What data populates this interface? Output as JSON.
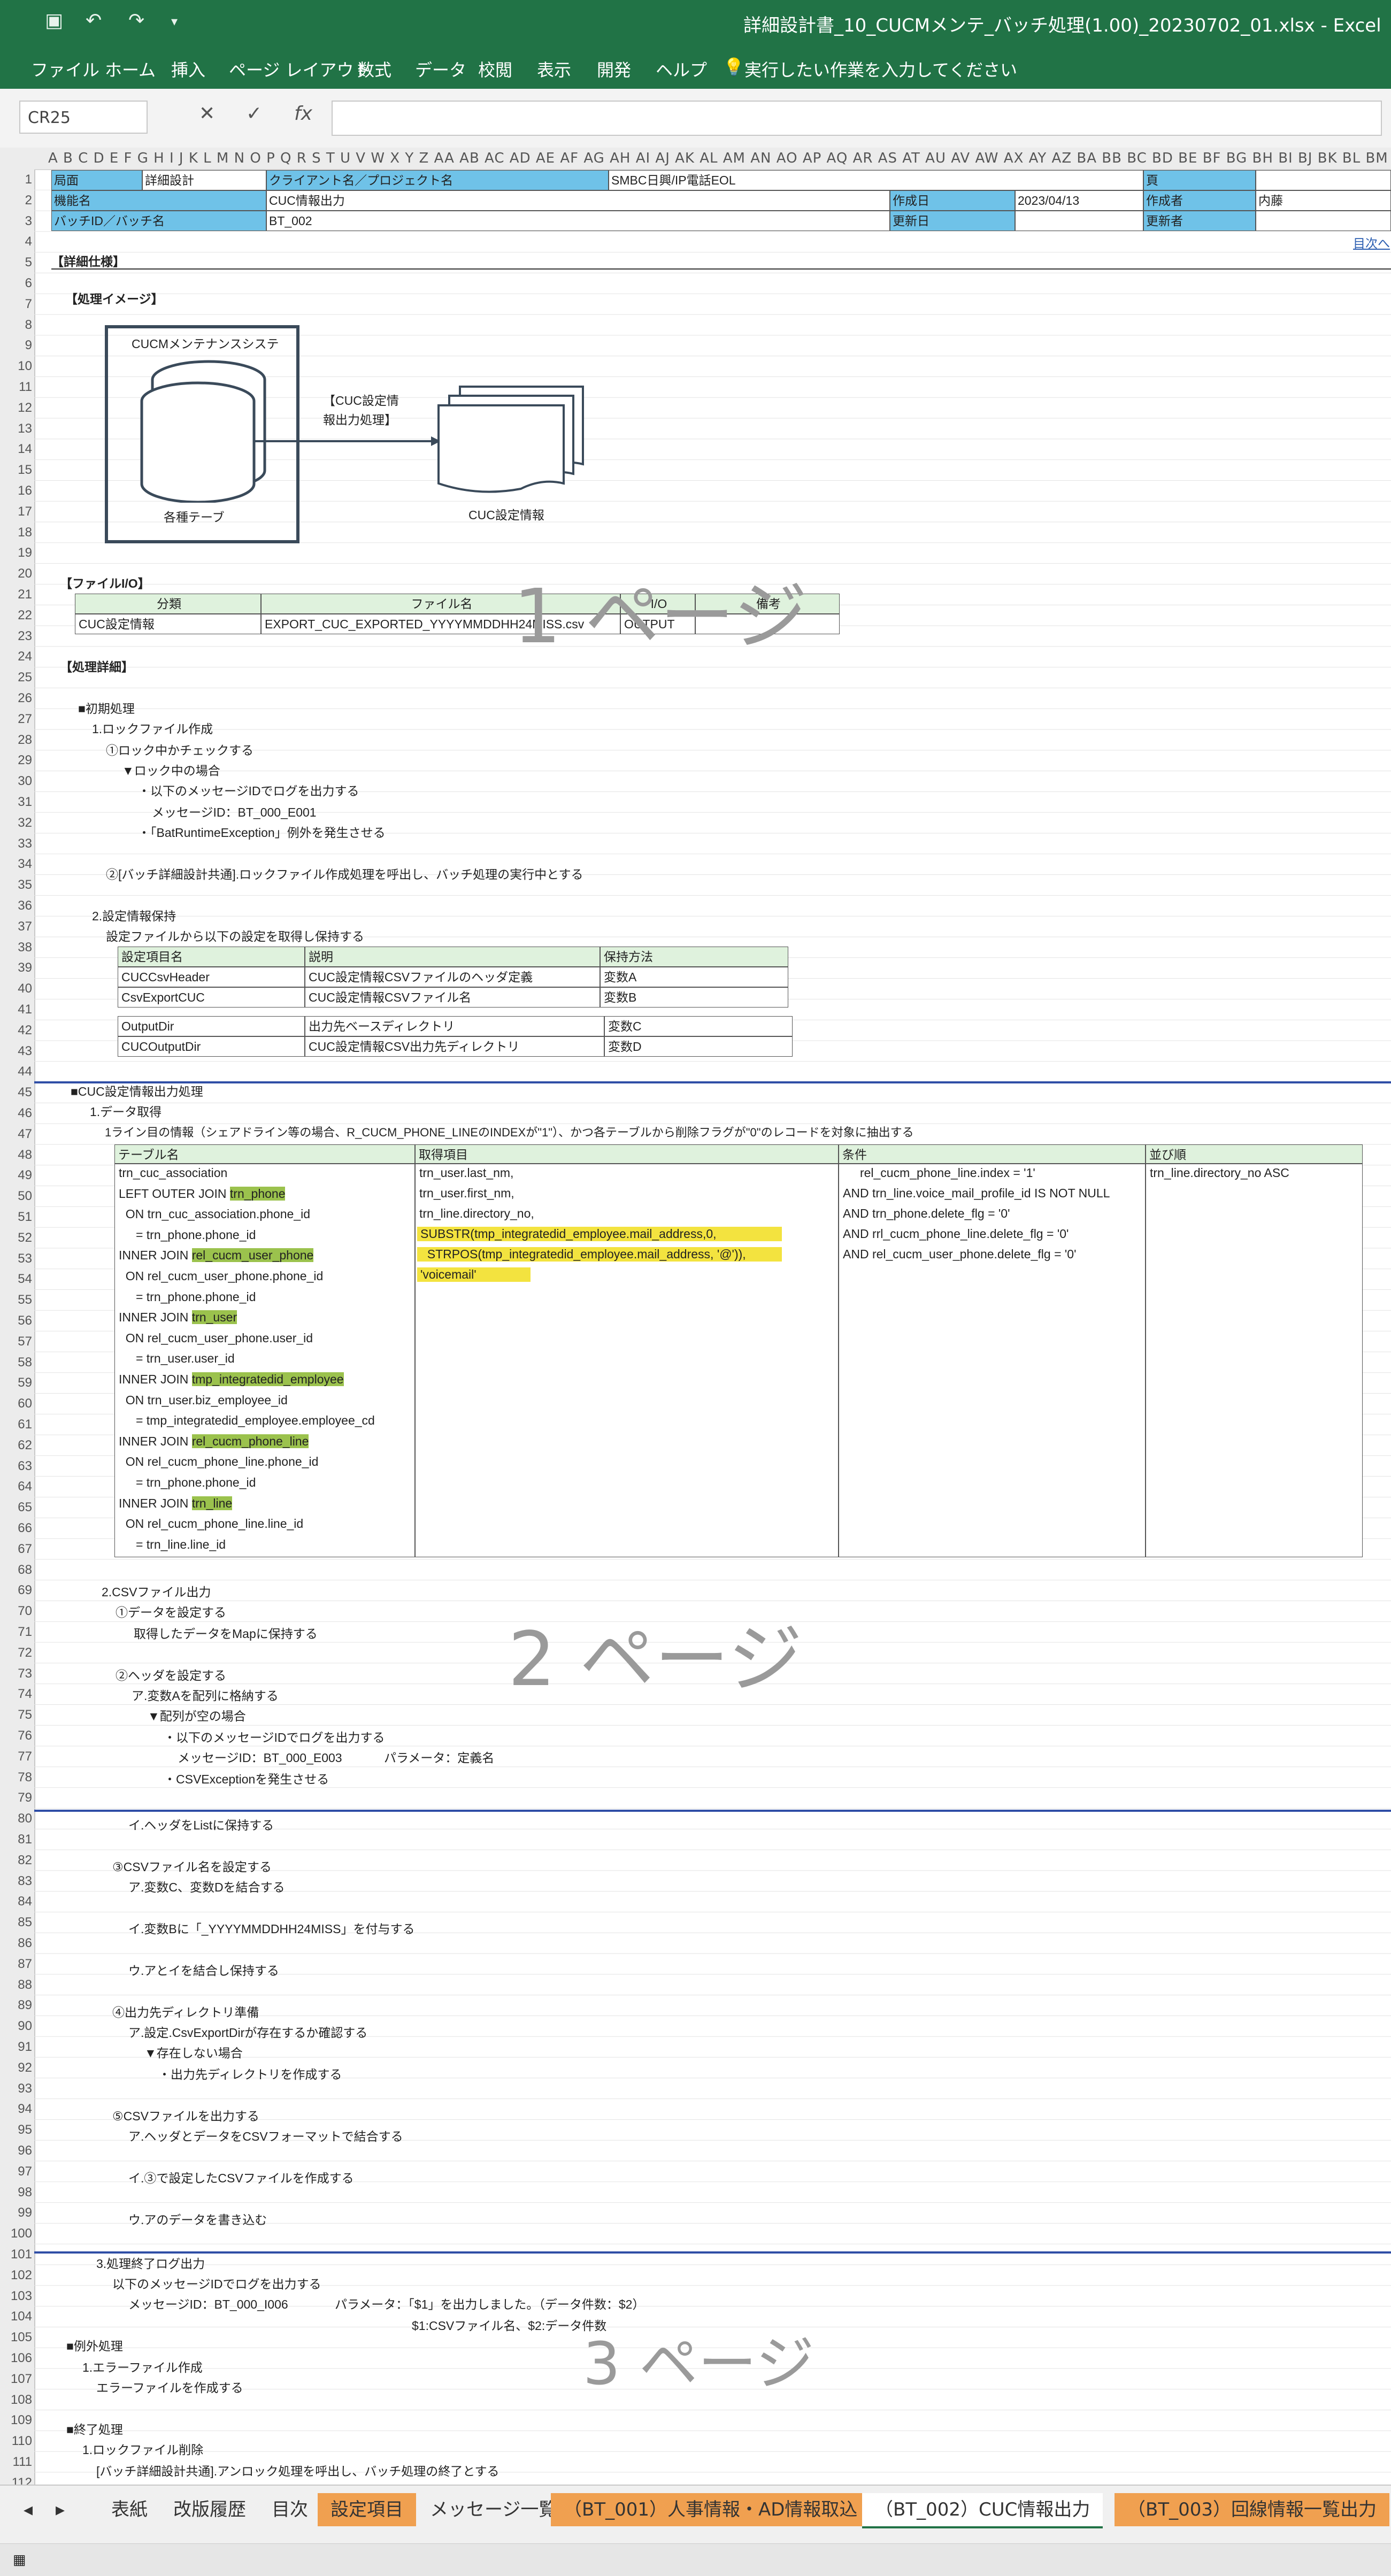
{
  "window": {
    "title": "詳細設計書_10_CUCMメンテ_バッチ処理(1.00)_20230702_01.xlsx  -  Excel"
  },
  "ribbon": {
    "tabs": [
      "ファイル",
      "ホーム",
      "挿入",
      "ページ レイアウト",
      "数式",
      "データ",
      "校閲",
      "表示",
      "開発",
      "ヘルプ"
    ],
    "tell_me": "実行したい作業を入力してください"
  },
  "formula_bar": {
    "name_box": "CR25",
    "cancel": "✕",
    "enter": "✓",
    "fx": "fx",
    "content": ""
  },
  "column_header_text": "A B C D E F G H  I  J K L M N O P Q R S T U V W X Y Z AA AB AC AD AE AF AG AH AI AJ AK AL AM AN AO AP AQ AR AS AT AU AV AW AX AY AZ BA BB BC BD BE BF BG BH BI BJ BK BL BM BN BO BP BQ BR BS BT BU BV BW BX BY BZ CA CB CC CD CE CF CG",
  "header": {
    "r1": [
      "局面",
      "詳細設計",
      "クライアント名／プロジェクト名",
      "SMBC日興/IP電話EOL",
      "頁"
    ],
    "r2": [
      "機能名",
      "CUC情報出力",
      "作成日",
      "2023/04/13",
      "作成者",
      "内藤"
    ],
    "r3": [
      "バッチID／バッチ名",
      "BT_002",
      "更新日",
      "更新者"
    ],
    "toc_link": "目次へ"
  },
  "section_detail": "【詳細仕様】",
  "process_image": {
    "heading": "【処理イメージ】",
    "system_label": "CUCMメンテナンスシステ",
    "db_label": "各種テーブ",
    "arrow_label_1": "【CUC設定情",
    "arrow_label_2": "報出力処理】",
    "doc_label": "CUC設定情報"
  },
  "file_io": {
    "heading": "【ファイルI/O】",
    "headers": [
      "分類",
      "ファイル名",
      "I/O",
      "備考"
    ],
    "row": [
      "CUC設定情報",
      "EXPORT_CUC_EXPORTED_YYYYMMDDHH24MISS.csv",
      "OUTPUT",
      ""
    ]
  },
  "process_detail_heading": "【処理詳細】",
  "init": {
    "title": "■初期処理",
    "lines": [
      "1.ロックファイル作成",
      "①ロック中かチェックする",
      "▼ロック中の場合",
      "・以下のメッセージIDでログを出力する",
      "メッセージID：BT_000_E001",
      "・「BatRuntimeException」例外を発生させる",
      "②[バッチ詳細設計共通].ロックファイル作成処理を呼出し、バッチ処理の実行中とする",
      "2.設定情報保持",
      "設定ファイルから以下の設定を取得し保持する"
    ]
  },
  "settings_table": {
    "headers": [
      "設定項目名",
      "説明",
      "保持方法"
    ],
    "rows": [
      [
        "CUCCsvHeader",
        "CUC設定情報CSVファイルのヘッダ定義",
        "変数A"
      ],
      [
        "CsvExportCUC",
        "CUC設定情報CSVファイル名",
        "変数B"
      ],
      [
        "OutputDir",
        "出力先ベースディレクトリ",
        "変数C"
      ],
      [
        "CUCOutputDir",
        "CUC設定情報CSV出力先ディレクトリ",
        "変数D"
      ]
    ]
  },
  "cuc_output": {
    "title": "■CUC設定情報出力処理",
    "sub": "1.データ取得",
    "desc": "1ライン目の情報（シェアドライン等の場合、R_CUCM_PHONE_LINEのINDEXが\"1\"）、かつ各テーブルから削除フラグが\"0\"のレコードを対象に抽出する"
  },
  "query_table": {
    "headers": [
      "テーブル名",
      "取得項目",
      "条件",
      "並び順"
    ],
    "tables": [
      [
        "trn_cuc_association",
        ""
      ],
      [
        "LEFT OUTER JOIN ",
        "trn_phone"
      ],
      [
        "  ON trn_cuc_association.phone_id",
        ""
      ],
      [
        "     = trn_phone.phone_id",
        ""
      ],
      [
        "INNER JOIN ",
        "rel_cucm_user_phone"
      ],
      [
        "  ON rel_cucm_user_phone.phone_id",
        ""
      ],
      [
        "     = trn_phone.phone_id",
        ""
      ],
      [
        "INNER JOIN ",
        "trn_user"
      ],
      [
        "  ON rel_cucm_user_phone.user_id",
        ""
      ],
      [
        "     = trn_user.user_id",
        ""
      ],
      [
        "INNER JOIN ",
        "tmp_integratedid_employee"
      ],
      [
        "  ON trn_user.biz_employee_id",
        ""
      ],
      [
        "     = tmp_integratedid_employee.employee_cd",
        ""
      ],
      [
        "INNER JOIN ",
        "rel_cucm_phone_line"
      ],
      [
        "  ON rel_cucm_phone_line.phone_id",
        ""
      ],
      [
        "     = trn_phone.phone_id",
        ""
      ],
      [
        "INNER JOIN ",
        "trn_line"
      ],
      [
        "  ON rel_cucm_phone_line.line_id",
        ""
      ],
      [
        "     = trn_line.line_id",
        ""
      ]
    ],
    "items": [
      "trn_user.last_nm,",
      "trn_user.first_nm,",
      "trn_line.directory_no,",
      "SUBSTR(tmp_integratedid_employee.mail_address,0,",
      "  STRPOS(tmp_integratedid_employee.mail_address, '@')),",
      "'voicemail'"
    ],
    "conditions": [
      "     rel_cucm_phone_line.index = '1'",
      "AND trn_line.voice_mail_profile_id IS NOT NULL",
      "AND trn_phone.delete_flg = '0'",
      "AND rrl_cucm_phone_line.delete_flg = '0'",
      "AND rel_cucm_user_phone.delete_flg = '0'"
    ],
    "order": "trn_line.directory_no ASC"
  },
  "csv_output": {
    "lines_a": [
      "2.CSVファイル出力",
      "①データを設定する",
      "取得したデータをMapに保持する",
      "②ヘッダを設定する",
      "ア.変数Aを配列に格納する",
      "▼配列が空の場合",
      "・以下のメッセージIDでログを出力する",
      "メッセージID：BT_000_E003",
      "パラメータ：定義名",
      "・CSVExceptionを発生させる"
    ],
    "lines_b": [
      "イ.ヘッダをListに保持する",
      "③CSVファイル名を設定する",
      "ア.変数C、変数Dを結合する",
      "イ.変数Bに「_YYYYMMDDHH24MISS」を付与する",
      "ウ.アとイを結合し保持する",
      "④出力先ディレクトリ準備",
      "ア.設定.CsvExportDirが存在するか確認する",
      "▼存在しない場合",
      "・出力先ディレクトリを作成する",
      "⑤CSVファイルを出力する",
      "ア.ヘッダとデータをCSVフォーマットで結合する",
      "イ.③で設定したCSVファイルを作成する",
      "ウ.アのデータを書き込む"
    ]
  },
  "end_proc": {
    "lines": [
      "3.処理終了ログ出力",
      "以下のメッセージIDでログを出力する",
      "メッセージID：BT_000_I006",
      "パラメータ：「$1」を出力しました。（データ件数：$2）",
      "$1:CSVファイル名、$2:データ件数",
      "■例外処理",
      "1.エラーファイル作成",
      "エラーファイルを作成する",
      "■終了処理",
      "1.ロックファイル削除",
      "[バッチ詳細設計共通].アンロック処理を呼出し、バッチ処理の終了とする"
    ]
  },
  "page_labels": [
    "1 ページ",
    "2 ページ",
    "3 ページ"
  ],
  "sheet_tabs": [
    "表紙",
    "改版履歴",
    "目次",
    "設定項目",
    "メッセージ一覧",
    "（BT_001）人事情報・AD情報取込",
    "（BT_002）CUC情報出力",
    "（BT_003）回線情報一覧出力"
  ],
  "colors": {
    "excel_green": "#217346",
    "header_blue": "#6fc2e8",
    "highlight_green": "#9bc24d",
    "highlight_yellow": "#f3e33f",
    "page_break": "#2f4ea6",
    "tab_orange": "#f0a050"
  }
}
